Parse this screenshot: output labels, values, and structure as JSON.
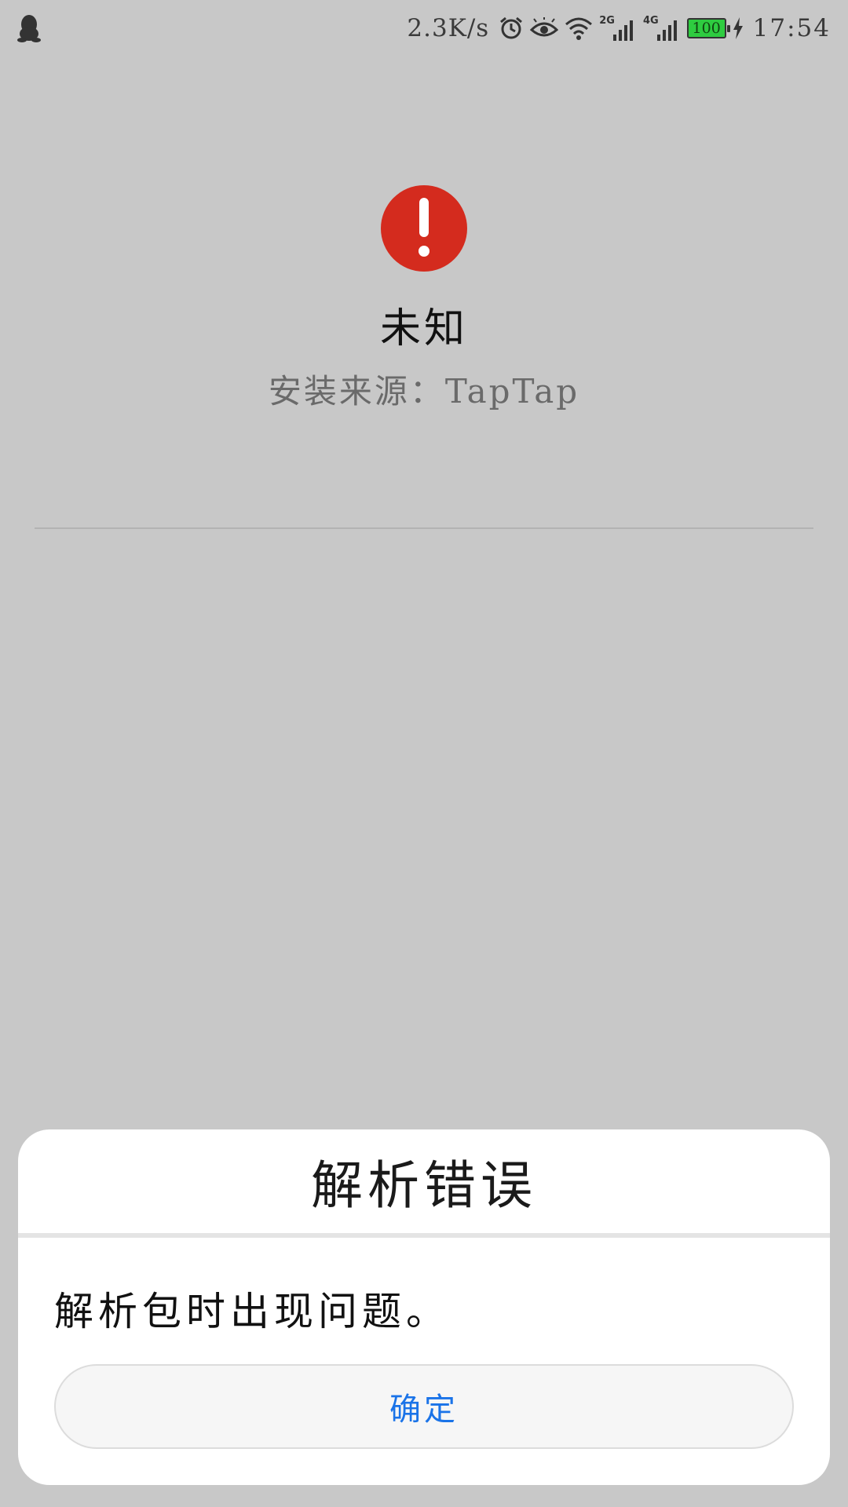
{
  "status_bar": {
    "net_speed": "2.3K/s",
    "network_2g": "2G",
    "network_4g": "4G",
    "battery": "100",
    "time": "17:54",
    "icons": [
      "qq-penguin-icon",
      "alarm-icon",
      "eye-icon",
      "wifi-icon",
      "signal-icon",
      "battery-icon",
      "charging-icon"
    ]
  },
  "app": {
    "name": "未知",
    "install_source": "安装来源：TapTap",
    "icon": "error-exclamation-icon",
    "icon_color": "#d42b1e"
  },
  "dialog": {
    "title": "解析错误",
    "message": "解析包时出现问题。",
    "confirm_label": "确定",
    "confirm_color": "#1a73e8"
  }
}
